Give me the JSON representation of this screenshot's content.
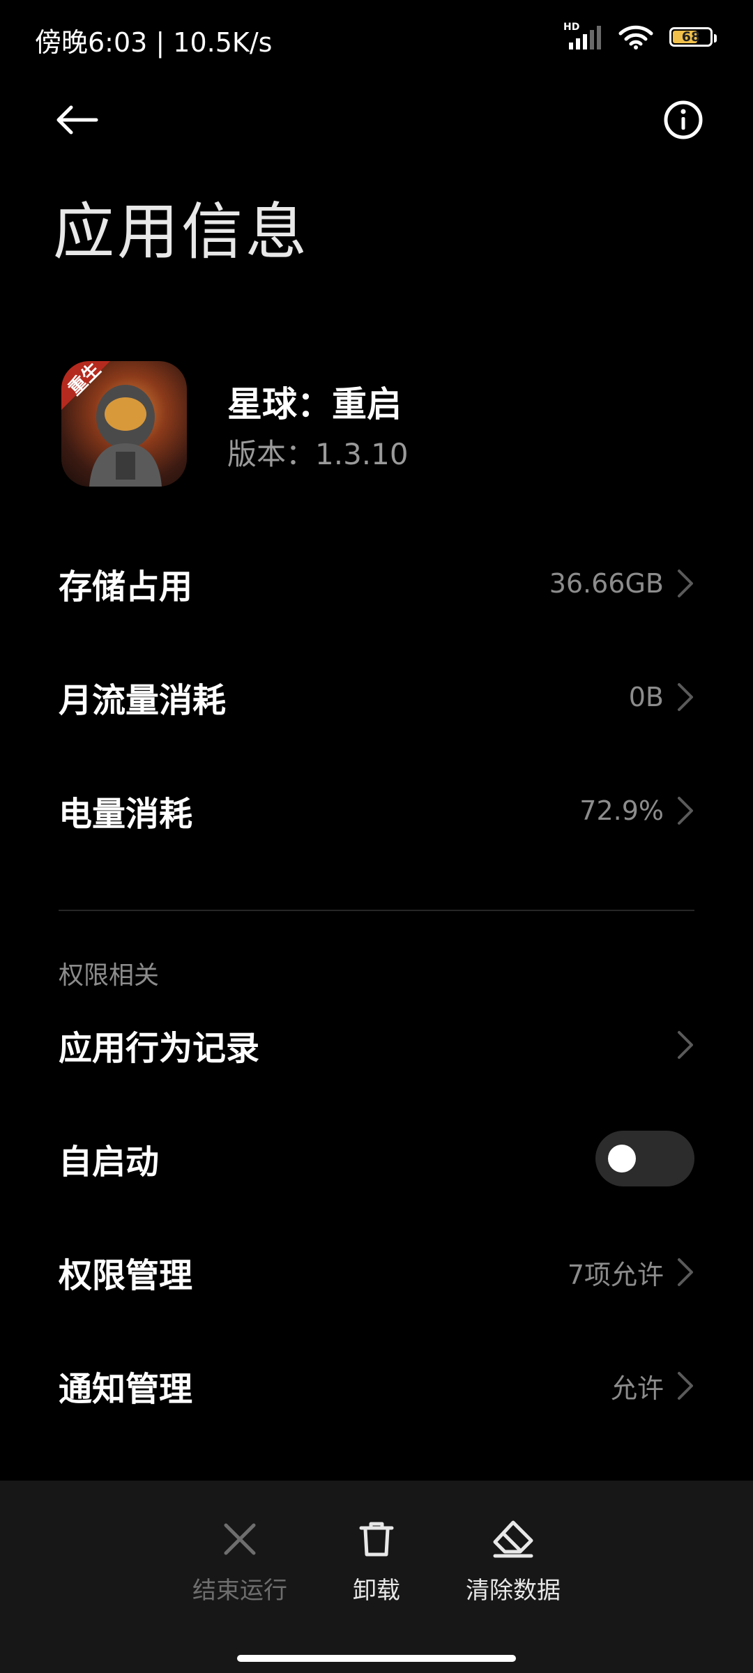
{
  "status_bar": {
    "time_speed": "傍晚6:03 | 10.5K/s",
    "hd_label": "HD",
    "battery_level": "68",
    "battery_fraction": 0.68,
    "battery_color": "#f2c14b",
    "icons": [
      "signal-icon",
      "wifi-icon",
      "battery-icon"
    ]
  },
  "header": {
    "back_icon": "arrow-left-icon",
    "info_icon": "info-circle-icon",
    "title": "应用信息"
  },
  "app": {
    "icon_badge": "重生",
    "name": "星球：重启",
    "version": "版本：1.3.10"
  },
  "usage": [
    {
      "label": "存储占用",
      "value": "36.66GB"
    },
    {
      "label": "月流量消耗",
      "value": "0B"
    },
    {
      "label": "电量消耗",
      "value": "72.9%"
    }
  ],
  "permissions": {
    "section_title": "权限相关",
    "behavior_record": {
      "label": "应用行为记录"
    },
    "autostart": {
      "label": "自启动",
      "enabled": false
    },
    "permission_manage": {
      "label": "权限管理",
      "value": "7项允许"
    },
    "notification_manage": {
      "label": "通知管理",
      "value": "允许"
    }
  },
  "bottom_actions": {
    "force_stop": {
      "label": "结束运行",
      "enabled": false
    },
    "uninstall": {
      "label": "卸载"
    },
    "clear_data": {
      "label": "清除数据"
    }
  }
}
